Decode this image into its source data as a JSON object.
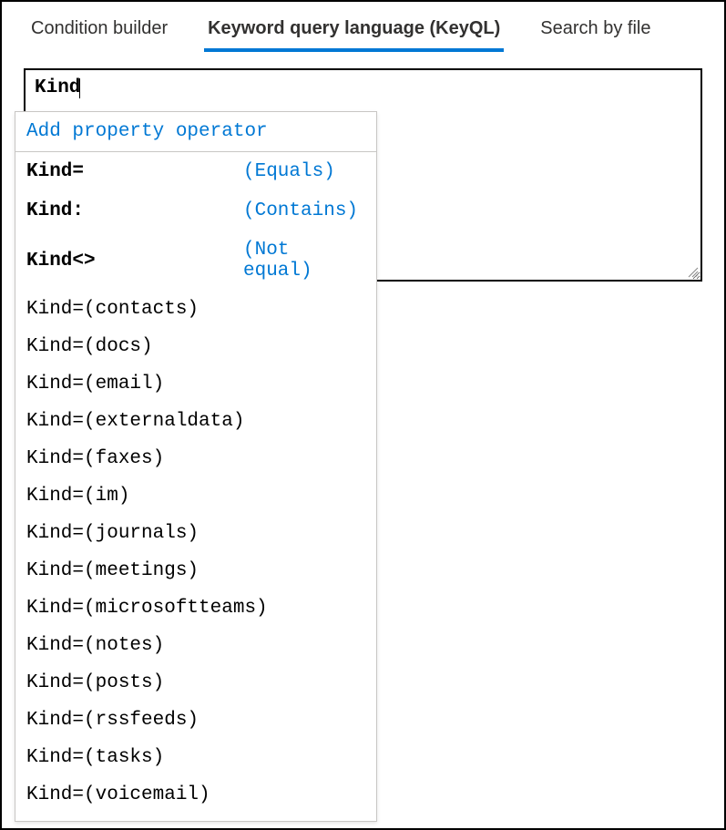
{
  "tabs": {
    "condition_builder": "Condition builder",
    "keyql": "Keyword query language (KeyQL)",
    "search_by_file": "Search by file"
  },
  "query": {
    "value": "Kind"
  },
  "suggest": {
    "header": "Add property operator",
    "operators": [
      {
        "key": "Kind=",
        "hint": "(Equals)"
      },
      {
        "key": "Kind:",
        "hint": "(Contains)"
      },
      {
        "key": "Kind<>",
        "hint": "(Not equal)"
      }
    ],
    "values": [
      "Kind=(contacts)",
      "Kind=(docs)",
      "Kind=(email)",
      "Kind=(externaldata)",
      "Kind=(faxes)",
      "Kind=(im)",
      "Kind=(journals)",
      "Kind=(meetings)",
      "Kind=(microsoftteams)",
      "Kind=(notes)",
      "Kind=(posts)",
      "Kind=(rssfeeds)",
      "Kind=(tasks)",
      "Kind=(voicemail)"
    ]
  }
}
